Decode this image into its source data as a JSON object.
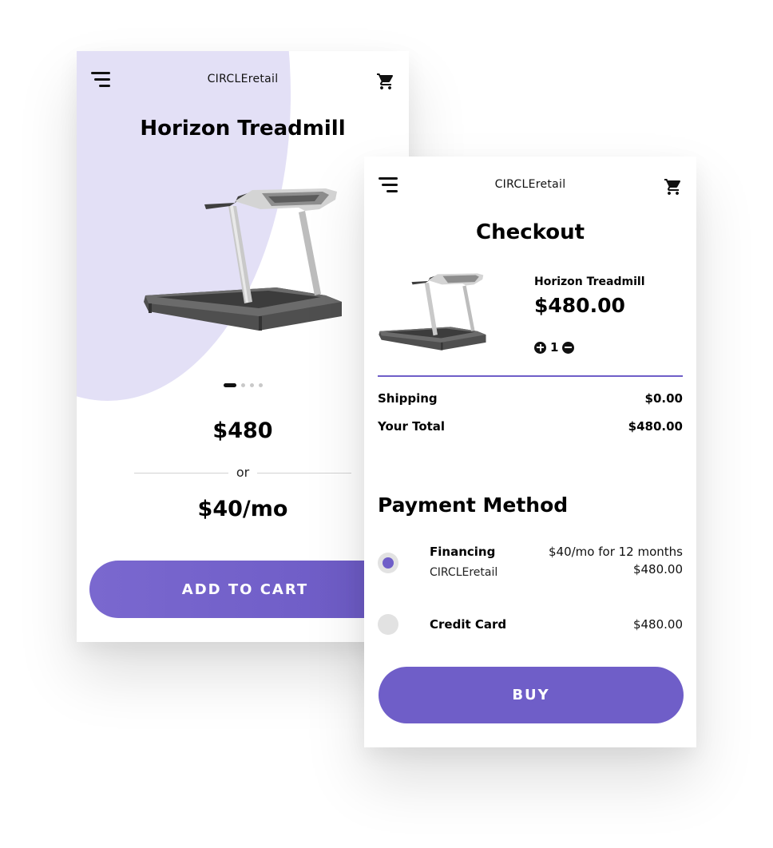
{
  "product_screen": {
    "brand": "CIRCLEretail",
    "title": "Horizon Treadmill",
    "carousel_pages": 4,
    "carousel_active_index": 0,
    "price": "$480",
    "or_text": "or",
    "monthly_price": "$40/mo",
    "add_to_cart_label": "ADD TO CART"
  },
  "checkout_screen": {
    "brand": "CIRCLEretail",
    "title": "Checkout",
    "item": {
      "name": "Horizon Treadmill",
      "price": "$480.00",
      "quantity": "1"
    },
    "summary": {
      "shipping_label": "Shipping",
      "shipping_value": "$0.00",
      "total_label": "Your Total",
      "total_value": "$480.00"
    },
    "payment": {
      "title": "Payment Method",
      "options": [
        {
          "name": "Financing",
          "sub": "CIRCLEretail",
          "terms": "$40/mo for 12 months",
          "amount": "$480.00",
          "selected": true
        },
        {
          "name": "Credit Card",
          "amount": "$480.00",
          "selected": false
        }
      ]
    },
    "buy_label": "BUY"
  },
  "icons": [
    "menu-icon",
    "cart-icon",
    "plus-icon",
    "minus-icon"
  ],
  "colors": {
    "accent": "#6f5ec8",
    "blob": "#e3e0f6",
    "radio_off": "#e2e2e2"
  }
}
